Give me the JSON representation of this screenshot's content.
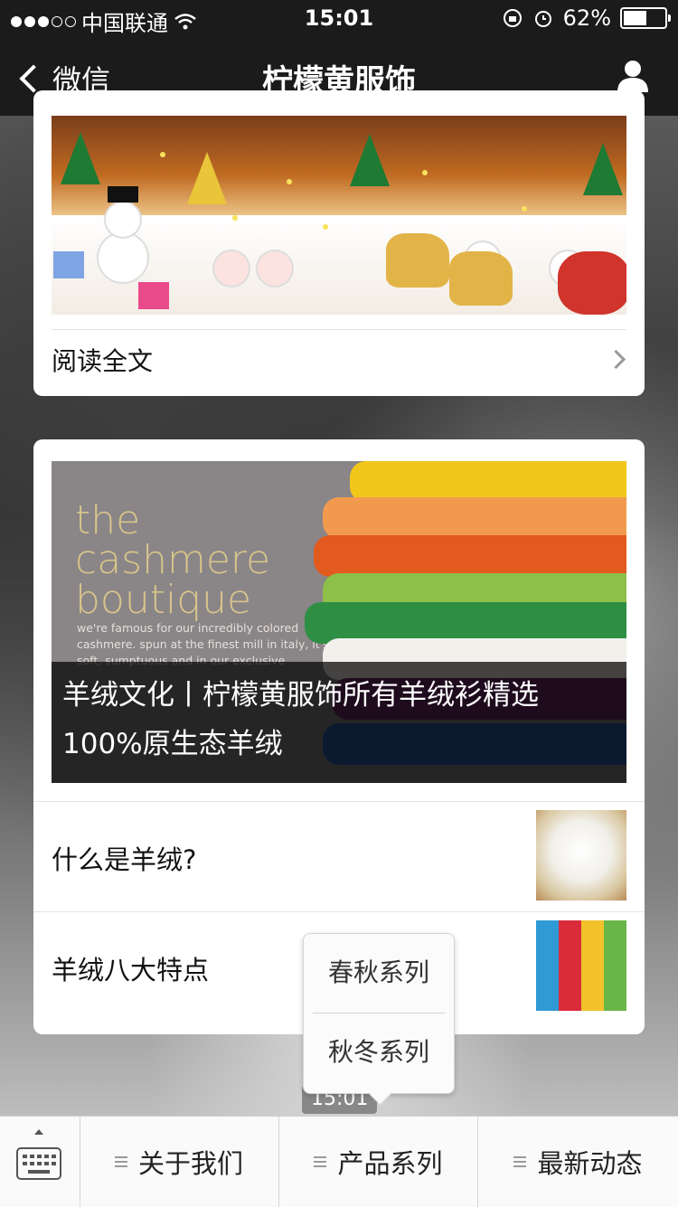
{
  "status_bar": {
    "carrier": "中国联通",
    "time": "15:01",
    "battery": "62%",
    "battery_level": 0.62
  },
  "nav": {
    "back_label": "微信",
    "title": "柠檬黄服饰"
  },
  "article1": {
    "read_all": "阅读全文"
  },
  "article2": {
    "cover_brand_lines": [
      "the",
      "cashmere",
      "boutique"
    ],
    "cover_small_text": "we're famous for our incredibly colored cashmere. spun at the finest mill in italy, it's soft, sumptuous and in our exclusive",
    "headline": "羊绒文化丨柠檬黄服饰所有羊绒衫精选100%原生态羊绒",
    "items": [
      {
        "label": "什么是羊绒?"
      },
      {
        "label": "羊绒八大特点"
      }
    ]
  },
  "popup_menu": {
    "options": [
      "春秋系列",
      "秋冬系列"
    ]
  },
  "message_time": "15:01",
  "bottom_menu": {
    "tabs": [
      "关于我们",
      "产品系列",
      "最新动态"
    ]
  },
  "colors": {
    "nav_bg": "#1b1b1b",
    "card_bg": "#ffffff",
    "text": "#111111"
  }
}
